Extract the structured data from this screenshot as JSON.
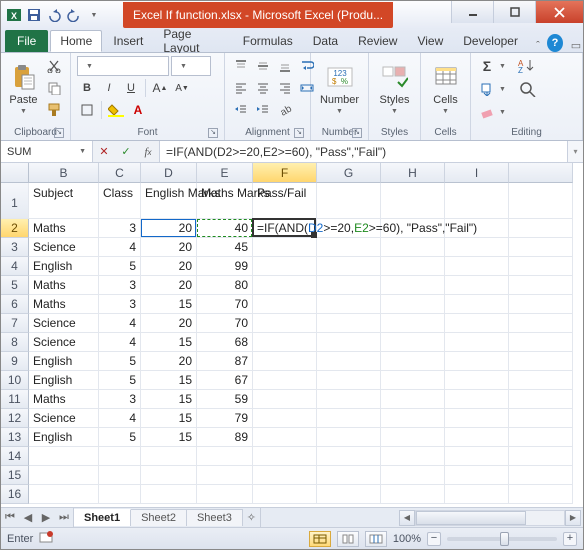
{
  "window": {
    "title": "Excel If function.xlsx - Microsoft Excel (Produ..."
  },
  "tabs": {
    "file": "File",
    "items": [
      "Home",
      "Insert",
      "Page Layout",
      "Formulas",
      "Data",
      "Review",
      "View",
      "Developer"
    ],
    "active": 0
  },
  "ribbon": {
    "clipboard": {
      "label": "Clipboard",
      "paste": "Paste"
    },
    "font": {
      "label": "Font",
      "name": "",
      "size": "",
      "bold": "B",
      "italic": "I",
      "underline": "U"
    },
    "alignment": {
      "label": "Alignment"
    },
    "number": {
      "label": "Number",
      "btn": "Number",
      "percent": "%"
    },
    "styles": {
      "label": "Styles",
      "btn": "Styles"
    },
    "cells": {
      "label": "Cells",
      "btn": "Cells"
    },
    "editing": {
      "label": "Editing",
      "sigma": "Σ"
    }
  },
  "formula_bar": {
    "namebox": "SUM",
    "formula": "=IF(AND(D2>=20,E2>=60), \"Pass\",\"Fail\")"
  },
  "columns": [
    "B",
    "C",
    "D",
    "E",
    "F",
    "G",
    "H",
    "I"
  ],
  "active_col_index": 4,
  "headers": {
    "B": "Subject",
    "C": "Class",
    "D": "English Marks",
    "E": "Maths Marks",
    "F": "Pass/Fail"
  },
  "rows": [
    {
      "n": 2,
      "B": "Maths",
      "C": 3,
      "D": 20,
      "E": 40
    },
    {
      "n": 3,
      "B": "Science",
      "C": 4,
      "D": 20,
      "E": 45
    },
    {
      "n": 4,
      "B": "English",
      "C": 5,
      "D": 20,
      "E": 99
    },
    {
      "n": 5,
      "B": "Maths",
      "C": 3,
      "D": 20,
      "E": 80
    },
    {
      "n": 6,
      "B": "Maths",
      "C": 3,
      "D": 15,
      "E": 70
    },
    {
      "n": 7,
      "B": "Science",
      "C": 4,
      "D": 20,
      "E": 70
    },
    {
      "n": 8,
      "B": "Science",
      "C": 4,
      "D": 15,
      "E": 68
    },
    {
      "n": 9,
      "B": "English",
      "C": 5,
      "D": 20,
      "E": 87
    },
    {
      "n": 10,
      "B": "English",
      "C": 5,
      "D": 15,
      "E": 67
    },
    {
      "n": 11,
      "B": "Maths",
      "C": 3,
      "D": 15,
      "E": 59
    },
    {
      "n": 12,
      "B": "Science",
      "C": 4,
      "D": 15,
      "E": 79
    },
    {
      "n": 13,
      "B": "English",
      "C": 5,
      "D": 15,
      "E": 89
    }
  ],
  "empty_row_count": 3,
  "cell_formula": {
    "pre": "=IF(",
    "fn": "AND",
    "open": "(",
    "r1": "D2",
    "mid1": ">=20,",
    "r2": "E2",
    "mid2": ">=60), \"Pass\",\"Fail\")"
  },
  "sheets": {
    "items": [
      "Sheet1",
      "Sheet2",
      "Sheet3"
    ],
    "active": 0
  },
  "status": {
    "mode": "Enter",
    "zoom": "100%"
  }
}
